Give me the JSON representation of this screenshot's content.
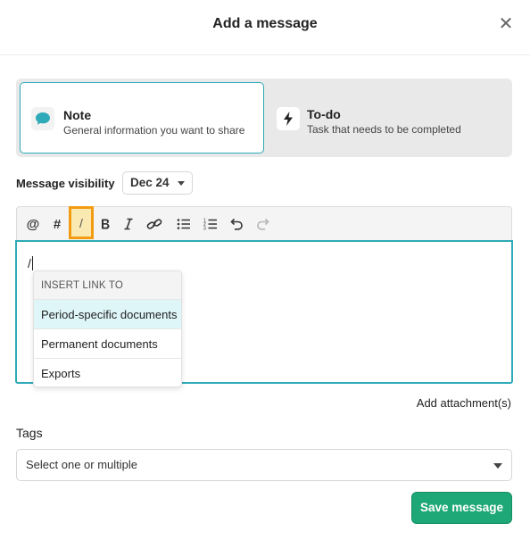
{
  "header": {
    "title": "Add a message",
    "close_icon": "close-icon"
  },
  "message_type": {
    "options": [
      {
        "id": "note",
        "label": "Note",
        "description": "General information you want to share",
        "icon": "speech-bubble-icon",
        "selected": true
      },
      {
        "id": "todo",
        "label": "To-do",
        "description": "Task that needs to be completed",
        "icon": "lightning-icon",
        "selected": false
      }
    ]
  },
  "visibility": {
    "label": "Message visibility",
    "value": "Dec 24"
  },
  "toolbar": {
    "buttons": [
      {
        "name": "mention",
        "glyph": "@"
      },
      {
        "name": "hashtag",
        "glyph": "#"
      },
      {
        "name": "slash",
        "glyph": "/",
        "active": true
      },
      {
        "name": "bold",
        "glyph": "B"
      },
      {
        "name": "italic",
        "glyph": "I"
      },
      {
        "name": "link",
        "glyph": "link"
      },
      {
        "name": "bullet-list",
        "glyph": "ul"
      },
      {
        "name": "numbered-list",
        "glyph": "ol"
      },
      {
        "name": "undo",
        "glyph": "undo"
      },
      {
        "name": "redo",
        "glyph": "redo"
      }
    ]
  },
  "editor": {
    "content": "/"
  },
  "insert_menu": {
    "header": "INSERT LINK TO",
    "items": [
      "Period-specific documents",
      "Permanent documents",
      "Exports"
    ],
    "highlighted_index": 0
  },
  "attachments": {
    "label": "Add attachment(s)"
  },
  "tags": {
    "label": "Tags",
    "placeholder": "Select one or multiple"
  },
  "actions": {
    "save_label": "Save message"
  },
  "colors": {
    "accent": "#2eaab8",
    "primary_button": "#1ea877",
    "highlight_border": "#f39c12"
  }
}
